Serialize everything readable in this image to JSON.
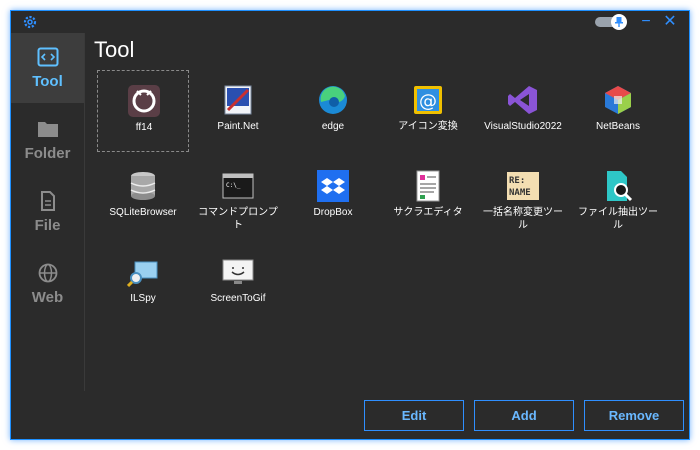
{
  "page_title": "Tool",
  "window_controls": {
    "minimize": "−",
    "close": "✕"
  },
  "sidebar": {
    "items": [
      {
        "label": "Tool",
        "icon": "code-window-icon",
        "active": true
      },
      {
        "label": "Folder",
        "icon": "folder-icon",
        "active": false
      },
      {
        "label": "File",
        "icon": "file-icon",
        "active": false
      },
      {
        "label": "Web",
        "icon": "globe-icon",
        "active": false
      }
    ]
  },
  "tools": [
    {
      "label": "ff14",
      "icon": "ff14-icon"
    },
    {
      "label": "Paint.Net",
      "icon": "paintnet-icon"
    },
    {
      "label": "edge",
      "icon": "edge-icon"
    },
    {
      "label": "アイコン変換",
      "icon": "icon-convert-icon"
    },
    {
      "label": "VisualStudio2022",
      "icon": "visual-studio-icon"
    },
    {
      "label": "NetBeans",
      "icon": "netbeans-icon"
    },
    {
      "label": "SQLiteBrowser",
      "icon": "database-icon"
    },
    {
      "label": "コマンドプロンプト",
      "icon": "command-prompt-icon",
      "term": "C:\\_"
    },
    {
      "label": "DropBox",
      "icon": "dropbox-icon"
    },
    {
      "label": "サクラエディタ",
      "icon": "sakura-editor-icon"
    },
    {
      "label": "一括名称変更ツール",
      "icon": "rename-tool-icon",
      "line1": "RE:",
      "line2": "NAME"
    },
    {
      "label": "ファイル抽出ツール",
      "icon": "file-search-icon"
    },
    {
      "label": "ILSpy",
      "icon": "ilspy-icon"
    },
    {
      "label": "ScreenToGif",
      "icon": "screentogif-icon"
    }
  ],
  "buttons": {
    "edit": "Edit",
    "add": "Add",
    "remove": "Remove"
  },
  "colors": {
    "accent": "#2f8fff",
    "sidebar_active": "#5fc0ff",
    "background": "#2b2b2b"
  }
}
